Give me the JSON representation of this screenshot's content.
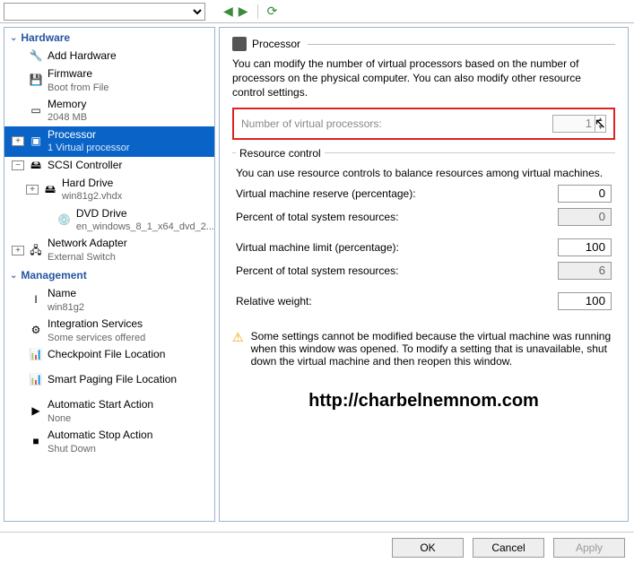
{
  "topbar": {
    "dropdown_value": ""
  },
  "tree": {
    "hardware_label": "Hardware",
    "management_label": "Management",
    "add_hardware": "Add Hardware",
    "firmware": "Firmware",
    "firmware_sub": "Boot from File",
    "memory": "Memory",
    "memory_sub": "2048 MB",
    "processor": "Processor",
    "processor_sub": "1 Virtual processor",
    "scsi": "SCSI Controller",
    "hdd": "Hard Drive",
    "hdd_sub": "win81g2.vhdx",
    "dvd": "DVD Drive",
    "dvd_sub": "en_windows_8_1_x64_dvd_2...",
    "nic": "Network Adapter",
    "nic_sub": "External Switch",
    "name": "Name",
    "name_sub": "win81g2",
    "integration": "Integration Services",
    "integration_sub": "Some services offered",
    "checkpoint": "Checkpoint File Location",
    "paging": "Smart Paging File Location",
    "autostart": "Automatic Start Action",
    "autostart_sub": "None",
    "autostop": "Automatic Stop Action",
    "autostop_sub": "Shut Down"
  },
  "panel": {
    "title": "Processor",
    "intro": "You can modify the number of virtual processors based on the number of processors on the physical computer. You can also modify other resource control settings.",
    "vproc_label": "Number of virtual processors:",
    "vproc_value": "1",
    "group_legend": "Resource control",
    "group_desc": "You can use resource controls to balance resources among virtual machines.",
    "reserve_label": "Virtual machine reserve (percentage):",
    "reserve_value": "0",
    "pct1_label": "Percent of total system resources:",
    "pct1_value": "0",
    "limit_label": "Virtual machine limit (percentage):",
    "limit_value": "100",
    "pct2_label": "Percent of total system resources:",
    "pct2_value": "6",
    "weight_label": "Relative weight:",
    "weight_value": "100",
    "warning": "Some settings cannot be modified because the virtual machine was running when this window was opened. To modify a setting that is unavailable, shut down the virtual machine and then reopen this window.",
    "watermark": "http://charbelnemnom.com"
  },
  "buttons": {
    "ok": "OK",
    "cancel": "Cancel",
    "apply": "Apply"
  }
}
